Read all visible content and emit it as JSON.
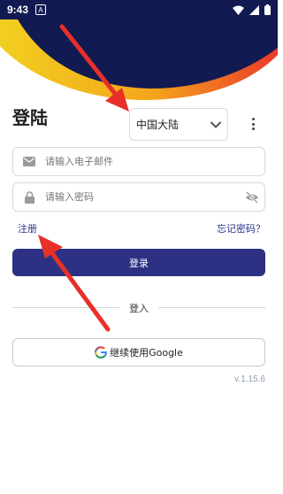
{
  "status_bar": {
    "time": "9:43",
    "notif_letter": "A"
  },
  "title": "登陆",
  "region": {
    "value": "中国大陆"
  },
  "email": {
    "placeholder": "请输入电子邮件"
  },
  "password": {
    "placeholder": "请输入密码"
  },
  "links": {
    "register": "注册",
    "forgot": "忘记密码？"
  },
  "login_button": "登录",
  "divider_label": "登入",
  "google_button": "继续使用Google",
  "version": "v.1.15.6",
  "colors": {
    "primary": "#2c3183",
    "hero_dark": "#121a52",
    "accent_yellow": "#f2c21b",
    "accent_red": "#e8312a"
  }
}
